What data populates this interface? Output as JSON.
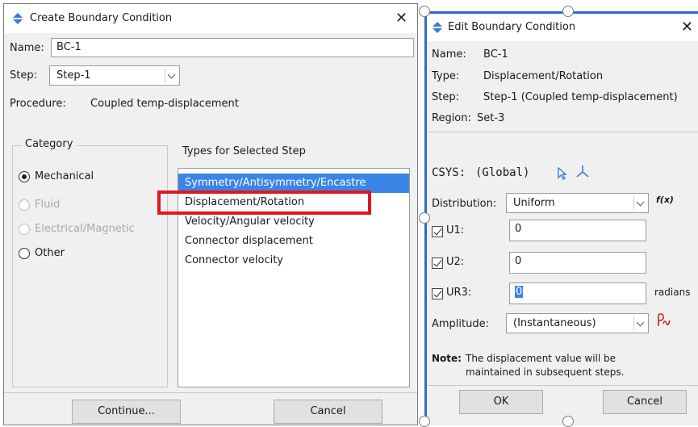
{
  "create_dialog": {
    "title": "Create Boundary Condition",
    "name_label": "Name:",
    "name_value": "BC-1",
    "step_label": "Step:",
    "step_value": "Step-1",
    "procedure_label": "Procedure:",
    "procedure_value": "Coupled temp-displacement",
    "category_title": "Category",
    "categories": [
      {
        "label": "Mechanical",
        "checked": true,
        "disabled": false
      },
      {
        "label": "Fluid",
        "checked": false,
        "disabled": true
      },
      {
        "label": "Electrical/Magnetic",
        "checked": false,
        "disabled": true
      },
      {
        "label": "Other",
        "checked": false,
        "disabled": false
      }
    ],
    "types_title": "Types for Selected Step",
    "types": [
      {
        "label": "Symmetry/Antisymmetry/Encastre",
        "selected": true
      },
      {
        "label": "Displacement/Rotation",
        "selected": false
      },
      {
        "label": "Velocity/Angular velocity",
        "selected": false
      },
      {
        "label": "Connector displacement",
        "selected": false
      },
      {
        "label": "Connector velocity",
        "selected": false
      }
    ],
    "continue_label": "Continue...",
    "cancel_label": "Cancel"
  },
  "edit_dialog": {
    "title": "Edit Boundary Condition",
    "name_label": "Name:",
    "name_value": "BC-1",
    "type_label": "Type:",
    "type_value": "Displacement/Rotation",
    "step_label": "Step:",
    "step_value": "Step-1 (Coupled temp-displacement)",
    "region_label": "Region:",
    "region_value": "Set-3",
    "csys_label": "CSYS:",
    "csys_value": "(Global)",
    "distribution_label": "Distribution:",
    "distribution_value": "Uniform",
    "fx_label": "f(x)",
    "dofs": [
      {
        "label": "U1:",
        "checked": true,
        "value": "0",
        "unit": ""
      },
      {
        "label": "U2:",
        "checked": true,
        "value": "0",
        "unit": ""
      },
      {
        "label": "UR3:",
        "checked": true,
        "value": "0",
        "unit": "radians"
      }
    ],
    "amplitude_label": "Amplitude:",
    "amplitude_value": "(Instantaneous)",
    "note_label": "Note:",
    "note_line1": "The displacement value will be",
    "note_line2": "maintained in subsequent steps.",
    "ok_label": "OK",
    "cancel_label": "Cancel"
  },
  "colors": {
    "selection_blue": "#3a86e6",
    "highlight_red": "#e0171f",
    "active_border": "#2b6cc4"
  }
}
